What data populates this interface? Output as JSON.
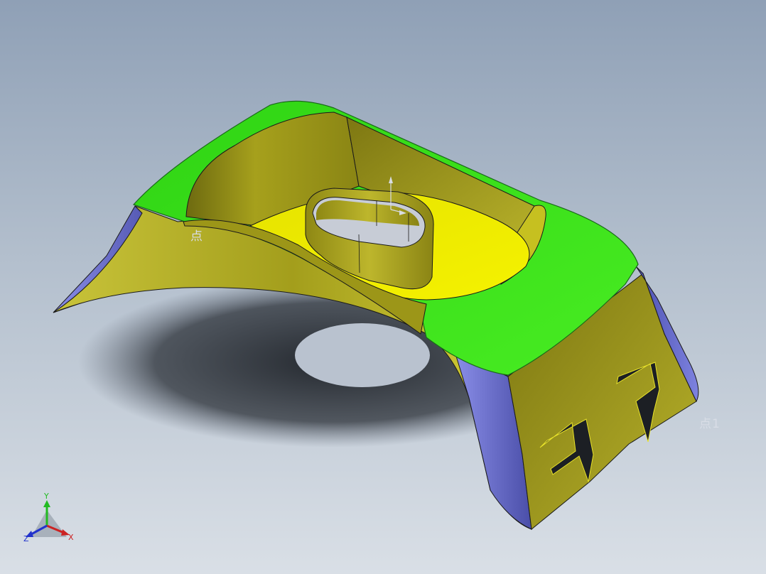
{
  "viewport": {
    "background_top": "#8fa0b6",
    "background_bottom": "#d9dfe6"
  },
  "model": {
    "face_colors": {
      "top_face": "#33e01a",
      "body_face": "#9c9618",
      "inner_face": "#d7d400",
      "side_face": "#6f73cc",
      "edge": "#1a1a1a"
    }
  },
  "labels": {
    "point_left": "点",
    "point_right": "点1"
  },
  "triad": {
    "x_label": "X",
    "y_label": "Y",
    "z_label": "Z",
    "x_color": "#cc2222",
    "y_color": "#22bb22",
    "z_color": "#2233cc"
  }
}
